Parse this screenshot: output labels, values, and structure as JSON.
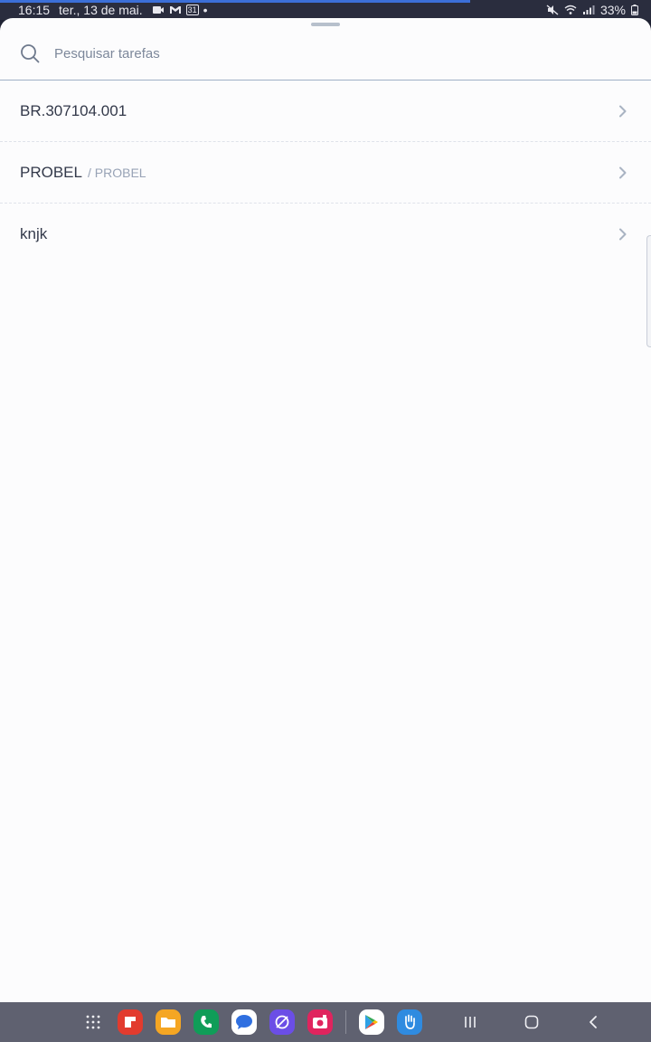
{
  "status_bar": {
    "time": "16:15",
    "date": "ter., 13 de mai.",
    "calendar_day": "31",
    "dot": "•",
    "battery": "33%"
  },
  "search": {
    "placeholder": "Pesquisar tarefas",
    "value": ""
  },
  "tasks": [
    {
      "title": "BR.307104.001",
      "subtitle": ""
    },
    {
      "title": "PROBEL",
      "subtitle": "/ PROBEL"
    },
    {
      "title": "knjk",
      "subtitle": ""
    }
  ],
  "nav_bar": {
    "apps": [
      {
        "icon": "flipboard-icon",
        "color": "#e23b2e"
      },
      {
        "icon": "folder-icon",
        "color": "#f5a623"
      },
      {
        "icon": "phone-icon",
        "color": "#0f9d58"
      },
      {
        "icon": "messages-icon",
        "color": "#2f6fe0"
      },
      {
        "icon": "internet-icon",
        "color": "#6b4ee6"
      },
      {
        "icon": "camera-icon",
        "color": "#e0245e"
      },
      {
        "icon": "play-store-icon",
        "color": "#ffffff"
      },
      {
        "icon": "hand-icon",
        "color": "#2f8be0"
      }
    ]
  }
}
